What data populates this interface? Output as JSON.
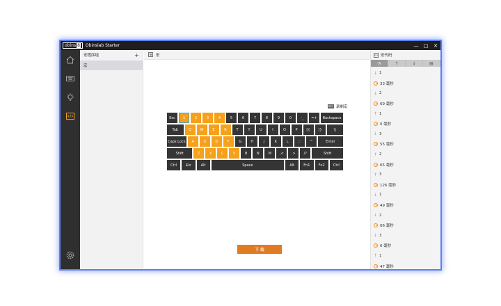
{
  "app": {
    "logo_text": "obins",
    "logo_mark": "8",
    "title": "Obinslab Starter"
  },
  "window_controls": {
    "minimize": "—",
    "maximize": "□",
    "close": "✕"
  },
  "rail": {
    "icons": [
      "home-icon",
      "keyboard-icon",
      "lightbulb-icon",
      "macro-code-icon",
      "gear-icon"
    ],
    "active": "macro-code-icon"
  },
  "left_panel": {
    "title": "宏程序组",
    "add_label": "+",
    "items": [
      "宏"
    ]
  },
  "main": {
    "header_title": "宏",
    "record_badge": "REC",
    "record_label": "录制宏",
    "next_button": "下 载"
  },
  "keyboard": {
    "rows": [
      [
        {
          "l": "Esc"
        },
        {
          "l": "1",
          "h": true,
          "sel": true
        },
        {
          "l": "2",
          "h": true
        },
        {
          "l": "3",
          "h": true
        },
        {
          "l": "4",
          "h": true
        },
        {
          "l": "5"
        },
        {
          "l": "6"
        },
        {
          "l": "7"
        },
        {
          "l": "8"
        },
        {
          "l": "9"
        },
        {
          "l": "0"
        },
        {
          "l": "-_"
        },
        {
          "l": "=+"
        },
        {
          "l": "Backspace",
          "w": 2
        }
      ],
      [
        {
          "l": "Tab",
          "w": 1.5
        },
        {
          "l": "Q",
          "h": true
        },
        {
          "l": "W",
          "h": true
        },
        {
          "l": "E",
          "h": true
        },
        {
          "l": "R",
          "h": true
        },
        {
          "l": "T"
        },
        {
          "l": "Y"
        },
        {
          "l": "U"
        },
        {
          "l": "I"
        },
        {
          "l": "O"
        },
        {
          "l": "P"
        },
        {
          "l": "[{"
        },
        {
          "l": "]}"
        },
        {
          "l": "\\|",
          "w": 1.5
        }
      ],
      [
        {
          "l": "Caps Lock",
          "w": 1.75
        },
        {
          "l": "A",
          "h": true
        },
        {
          "l": "S",
          "h": true
        },
        {
          "l": "D",
          "h": true
        },
        {
          "l": "F",
          "h": true
        },
        {
          "l": "G"
        },
        {
          "l": "H"
        },
        {
          "l": "J"
        },
        {
          "l": "K"
        },
        {
          "l": "L"
        },
        {
          "l": ";:"
        },
        {
          "l": "'\""
        },
        {
          "l": "Enter",
          "w": 2.25
        }
      ],
      [
        {
          "l": "Shift",
          "w": 2.25
        },
        {
          "l": "Z",
          "h": true
        },
        {
          "l": "X",
          "h": true
        },
        {
          "l": "C",
          "h": true
        },
        {
          "l": "V",
          "h": true
        },
        {
          "l": "B"
        },
        {
          "l": "N"
        },
        {
          "l": "M"
        },
        {
          "l": ",<"
        },
        {
          "l": ".>"
        },
        {
          "l": "/?"
        },
        {
          "l": "Shift",
          "w": 2.75
        }
      ],
      [
        {
          "l": "Ctrl",
          "w": 1.25
        },
        {
          "l": "⊞✕",
          "w": 1.25
        },
        {
          "l": "Alt",
          "w": 1.25
        },
        {
          "l": "Space",
          "w": 6.25
        },
        {
          "l": "Alt",
          "w": 1.25
        },
        {
          "l": "Fn1",
          "w": 1.25
        },
        {
          "l": "Fn2",
          "w": 1.25
        },
        {
          "l": "Ctrl",
          "w": 1.25
        }
      ]
    ]
  },
  "right_panel": {
    "title": "宏代码",
    "toolbar": [
      "clock-icon",
      "arrow-up-icon",
      "arrow-down-icon",
      "delete-icon"
    ],
    "toolbar_glyphs": [
      "◷",
      "↑",
      "↓",
      "▤"
    ],
    "entries": [
      {
        "kind": "down",
        "text": "1"
      },
      {
        "kind": "delay",
        "text": "33 毫秒"
      },
      {
        "kind": "down",
        "text": "2"
      },
      {
        "kind": "delay",
        "text": "69 毫秒"
      },
      {
        "kind": "up",
        "text": "1"
      },
      {
        "kind": "delay",
        "text": "0 毫秒"
      },
      {
        "kind": "down",
        "text": "3"
      },
      {
        "kind": "delay",
        "text": "55 毫秒"
      },
      {
        "kind": "up",
        "text": "2"
      },
      {
        "kind": "delay",
        "text": "65 毫秒"
      },
      {
        "kind": "up",
        "text": "3"
      },
      {
        "kind": "delay",
        "text": "126 毫秒"
      },
      {
        "kind": "down",
        "text": "1"
      },
      {
        "kind": "delay",
        "text": "49 毫秒"
      },
      {
        "kind": "down",
        "text": "2"
      },
      {
        "kind": "delay",
        "text": "66 毫秒"
      },
      {
        "kind": "down",
        "text": "3"
      },
      {
        "kind": "delay",
        "text": "6 毫秒"
      },
      {
        "kind": "up",
        "text": "1"
      },
      {
        "kind": "delay",
        "text": "47 毫秒"
      }
    ]
  },
  "colors": {
    "accent": "#f6a11a",
    "button": "#e07b23",
    "key": "#353535",
    "rail": "#2f2f2f",
    "window_glow": "#5b7ff5"
  }
}
